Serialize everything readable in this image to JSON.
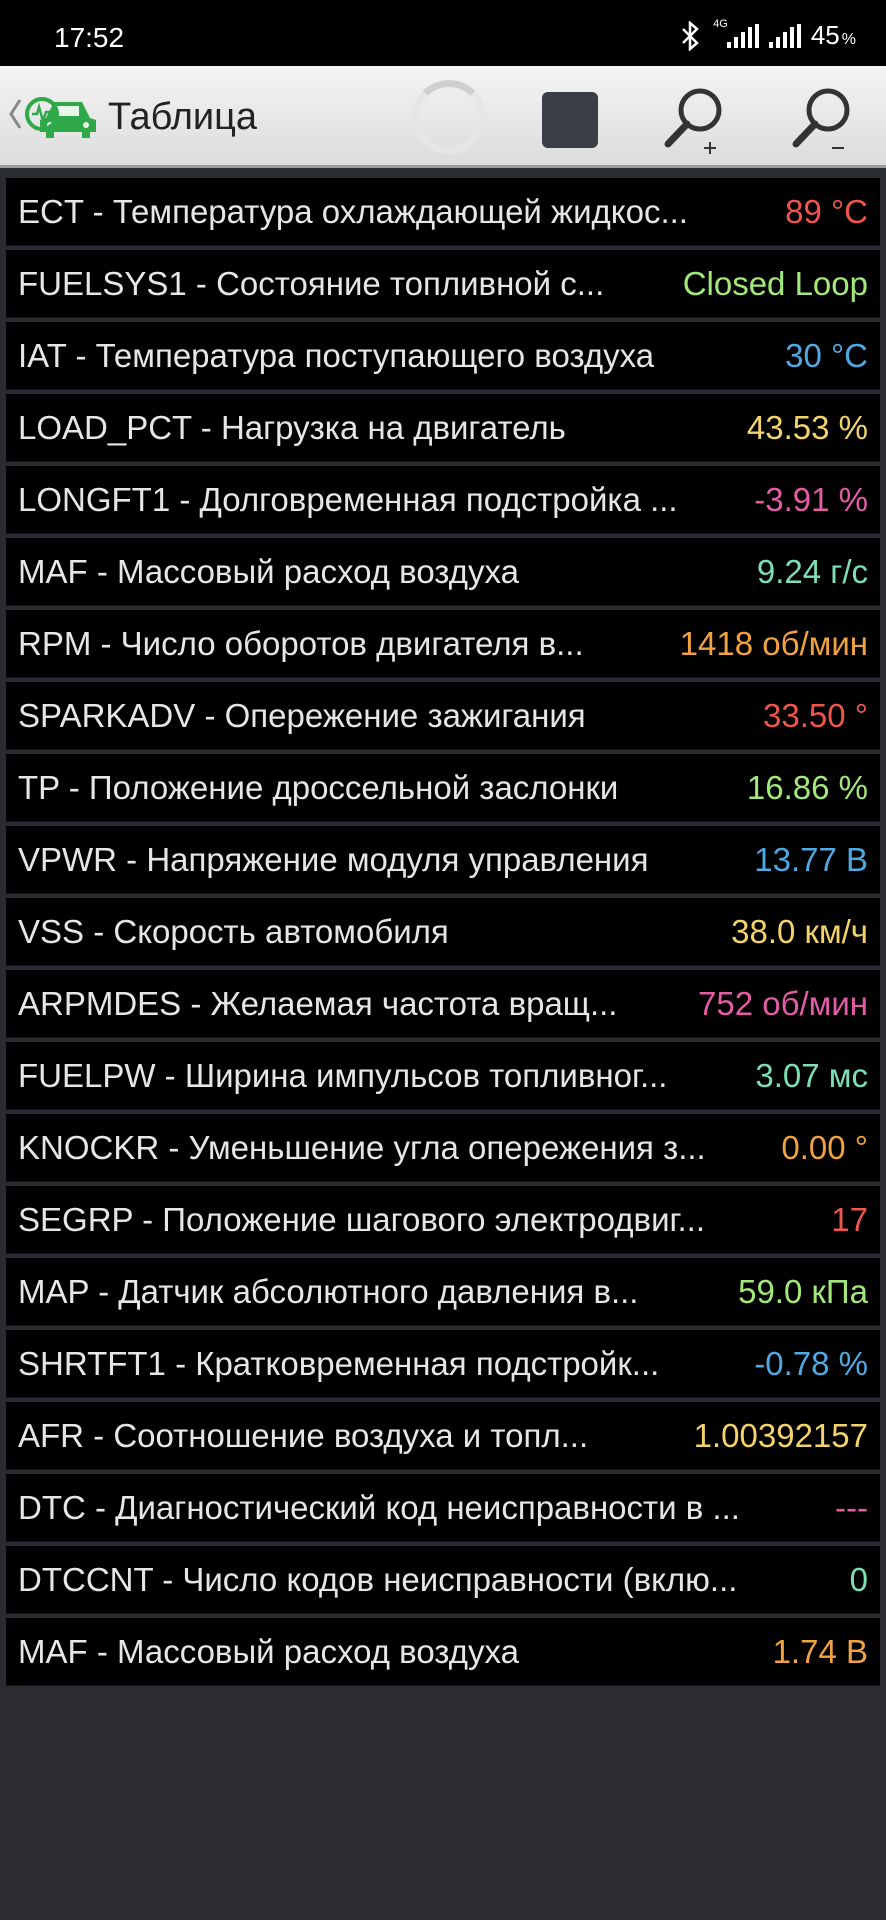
{
  "status_bar": {
    "time": "17:52",
    "network_label": "4G",
    "battery_percent": "45",
    "battery_unit": "%"
  },
  "toolbar": {
    "title": "Таблица",
    "icons": {
      "back": "chevron-left-icon",
      "logo": "car-diagnostic-logo",
      "stop": "stop-icon",
      "zoom_in": "zoom-in-icon",
      "zoom_out": "zoom-out-icon"
    }
  },
  "colors": {
    "red": "#f0554a",
    "green": "#a3e87a",
    "blue": "#4ea9e3",
    "yellow": "#f4d46a",
    "pink": "#e35ca6",
    "teal": "#7cdfb5",
    "orange": "#f2a240",
    "light_orange": "#f2b04a"
  },
  "rows": [
    {
      "label": "ECT - Температура охлаждающей жидкос...",
      "value": "89 °C",
      "color": "#f0554a"
    },
    {
      "label": "FUELSYS1 - Состояние топливной с...",
      "value": "Closed Loop",
      "color": "#a3e87a"
    },
    {
      "label": "IAT - Температура поступающего воздуха",
      "value": "30 °C",
      "color": "#4ea9e3"
    },
    {
      "label": "LOAD_PCT - Нагрузка на двигатель",
      "value": "43.53 %",
      "color": "#f4d46a"
    },
    {
      "label": "LONGFT1 - Долговременная подстройка ...",
      "value": "-3.91 %",
      "color": "#e35ca6"
    },
    {
      "label": "MAF - Массовый расход воздуха",
      "value": "9.24 г/с",
      "color": "#7cdfb5"
    },
    {
      "label": "RPM - Число оборотов двигателя в...",
      "value": "1418 об/мин",
      "color": "#f2a240"
    },
    {
      "label": "SPARKADV - Опережение зажигания",
      "value": "33.50 °",
      "color": "#f0554a"
    },
    {
      "label": "TP - Положение дроссельной заслонки",
      "value": "16.86 %",
      "color": "#a3e87a"
    },
    {
      "label": "VPWR - Напряжение модуля управления",
      "value": "13.77 В",
      "color": "#4ea9e3"
    },
    {
      "label": "VSS - Скорость автомобиля",
      "value": "38.0 км/ч",
      "color": "#f4d46a"
    },
    {
      "label": "ARPMDES - Желаемая частота вращ...",
      "value": "752 об/мин",
      "color": "#e35ca6"
    },
    {
      "label": "FUELPW - Ширина импульсов топливног...",
      "value": "3.07 мс",
      "color": "#7cdfb5"
    },
    {
      "label": "KNOCKR - Уменьшение угла опережения з...",
      "value": "0.00 °",
      "color": "#f2a240"
    },
    {
      "label": "SEGRP - Положение шагового электродвиг...",
      "value": "17",
      "color": "#f0554a"
    },
    {
      "label": "MAP - Датчик абсолютного давления в...",
      "value": "59.0 кПа",
      "color": "#a3e87a"
    },
    {
      "label": "SHRTFT1 - Кратковременная подстройк...",
      "value": "-0.78 %",
      "color": "#4ea9e3"
    },
    {
      "label": "AFR - Соотношение воздуха и топл...",
      "value": "1.00392157",
      "color": "#f4d46a"
    },
    {
      "label": "DTC - Диагностический код неисправности в ...",
      "value": "---",
      "color": "#e35ca6"
    },
    {
      "label": "DTCCNT - Число кодов неисправности (вклю...",
      "value": "0",
      "color": "#7cdfb5"
    },
    {
      "label": "MAF - Массовый расход воздуха",
      "value": "1.74 В",
      "color": "#f2a240"
    }
  ]
}
